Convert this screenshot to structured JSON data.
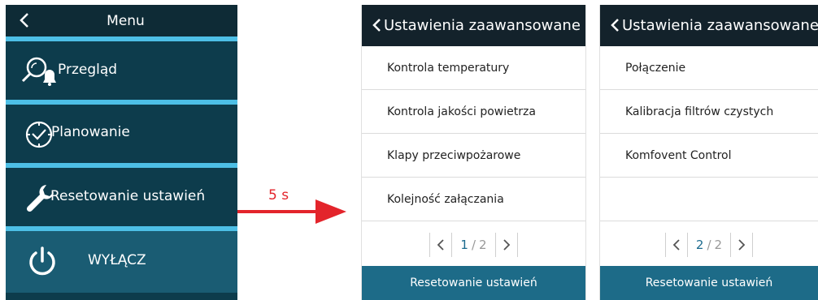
{
  "menu": {
    "title": "Menu",
    "items": [
      {
        "label": "Przegląd",
        "icon": "search-alarm-icon"
      },
      {
        "label": "Planowanie",
        "icon": "clock-icon"
      },
      {
        "label": "Resetowanie ustawień",
        "icon": "wrench-icon"
      },
      {
        "label": "WYŁĄCZ",
        "icon": "power-icon"
      }
    ]
  },
  "transition": {
    "label": "5 s",
    "color": "#e3242b"
  },
  "panel1": {
    "title": "Ustawienia zaawansowane",
    "rows": [
      "Kontrola temperatury",
      "Kontrola jakości powietrza",
      "Klapy przeciwpożarowe",
      "Kolejność załączania"
    ],
    "pager": {
      "current": "1",
      "sep": "/",
      "total": "2"
    },
    "footer": "Resetowanie ustawień"
  },
  "panel2": {
    "title": "Ustawienia zaawansowane",
    "rows": [
      "Połączenie",
      "Kalibracja filtrów czystych",
      "Komfovent Control",
      ""
    ],
    "pager": {
      "current": "2",
      "sep": "/",
      "total": "2"
    },
    "footer": "Resetowanie ustawień"
  },
  "colors": {
    "menu_bg": "#0d3c4c",
    "separator": "#4dbfe6",
    "header_dark": "#13222b",
    "footer": "#1d6b88"
  }
}
